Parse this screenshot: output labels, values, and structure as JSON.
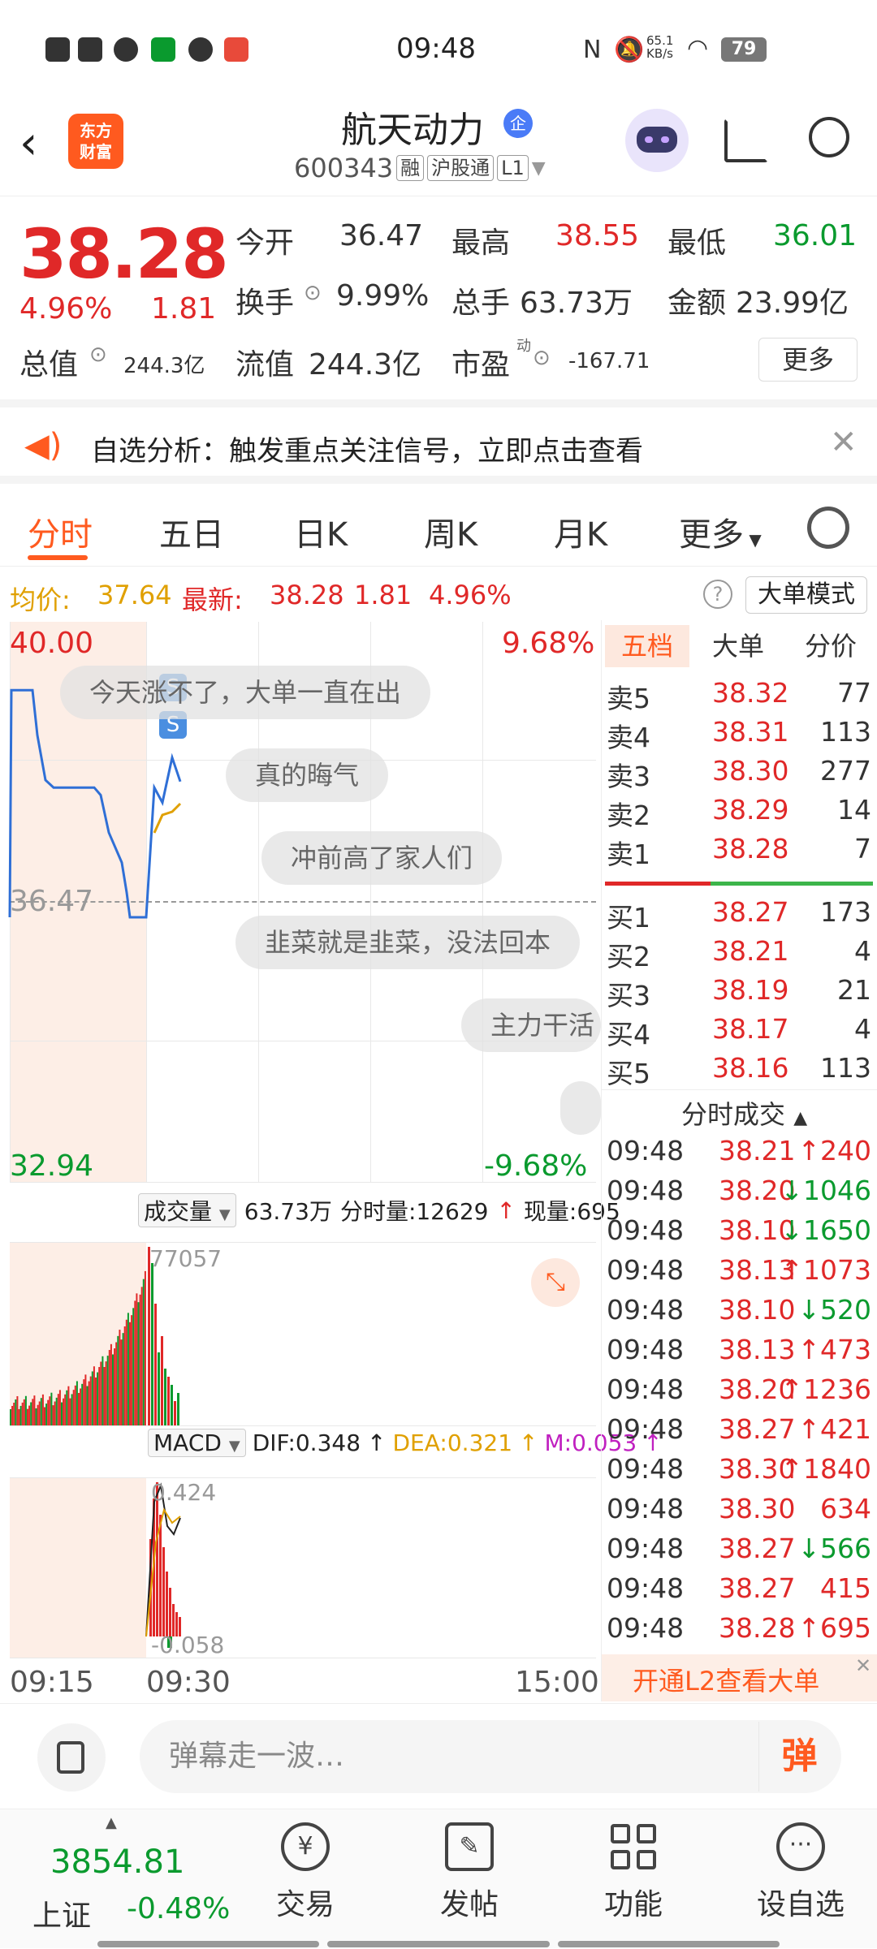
{
  "status_bar": {
    "time": "09:48",
    "net_speed": "65.1 KB/s",
    "battery": "79"
  },
  "header": {
    "logo_text_1": "东方",
    "logo_text_2": "财富",
    "stock_name": "航天动力",
    "name_badge": "企",
    "stock_code": "600343",
    "tags": [
      "融",
      "沪股通",
      "L1"
    ]
  },
  "quote": {
    "price": "38.28",
    "change_pct": "4.96%",
    "change": "1.81",
    "open_label": "今开",
    "open": "36.47",
    "high_label": "最高",
    "high": "38.55",
    "low_label": "最低",
    "low": "36.01",
    "turnover_label": "换手",
    "turnover": "9.99%",
    "volume_label": "总手",
    "volume": "63.73万",
    "amount_label": "金额",
    "amount": "23.99亿",
    "mcap_label": "总值",
    "mcap": "244.3亿",
    "float_label": "流值",
    "float": "244.3亿",
    "pe_label": "市盈",
    "pe_sup": "动",
    "pe": "-167.71",
    "more": "更多"
  },
  "banner": {
    "text": "自选分析：触发重点关注信号，立即点击查看"
  },
  "tabs": [
    "分时",
    "五日",
    "日K",
    "周K",
    "月K",
    "更多"
  ],
  "info_line": {
    "avg_label": "均价:",
    "avg": "37.64",
    "latest_label": "最新:",
    "latest": "38.28",
    "chg": "1.81",
    "chg_pct": "4.96%",
    "mode": "大单模式"
  },
  "chart": {
    "y_top": "40.00",
    "y_mid": "36.47",
    "y_bot": "32.94",
    "pct_top": "9.68%",
    "pct_bot": "-9.68%",
    "vol_label": "成交量",
    "vol_total": "63.73万",
    "vol_fenshi": "分时量:12629",
    "vol_now": "现量:695",
    "vol_max": "77057",
    "macd_label": "MACD",
    "dif": "DIF:0.348",
    "dea": "DEA:0.321",
    "m": "M:0.053",
    "macd_top": "0.424",
    "macd_bot": "-0.058",
    "time_start": "09:15",
    "time_mid": "09:30",
    "time_end": "15:00"
  },
  "danmu": [
    "今天涨不了，大单一直在出",
    "真的晦气",
    "冲前高了家人们",
    "韭菜就是韭菜，没法回本",
    "主力干活"
  ],
  "chart_data": {
    "type": "line",
    "title": "",
    "xlabel": "",
    "ylabel": "",
    "ylim": [
      32.94,
      40.0
    ],
    "series": [
      {
        "values": [
          36.47,
          39.5,
          39.5,
          38.9,
          38.3,
          38.2,
          38.2,
          38.2,
          38.1,
          37.6,
          37.2,
          36.8,
          36.47,
          36.47,
          38.2,
          38.0,
          38.6,
          38.28
        ]
      }
    ]
  },
  "book": {
    "tabs": [
      "五档",
      "大单",
      "分价"
    ],
    "sell": [
      {
        "label": "卖5",
        "price": "38.32",
        "vol": "77"
      },
      {
        "label": "卖4",
        "price": "38.31",
        "vol": "113"
      },
      {
        "label": "卖3",
        "price": "38.30",
        "vol": "277"
      },
      {
        "label": "卖2",
        "price": "38.29",
        "vol": "14"
      },
      {
        "label": "卖1",
        "price": "38.28",
        "vol": "7"
      }
    ],
    "buy": [
      {
        "label": "买1",
        "price": "38.27",
        "vol": "173"
      },
      {
        "label": "买2",
        "price": "38.21",
        "vol": "4"
      },
      {
        "label": "买3",
        "price": "38.19",
        "vol": "21"
      },
      {
        "label": "买4",
        "price": "38.17",
        "vol": "4"
      },
      {
        "label": "买5",
        "price": "38.16",
        "vol": "113"
      }
    ],
    "trades_title": "分时成交",
    "trades": [
      {
        "t": "09:48",
        "p": "38.21",
        "d": "↑",
        "v": "240",
        "c": "red"
      },
      {
        "t": "09:48",
        "p": "38.20",
        "d": "↓",
        "v": "1046",
        "c": "green"
      },
      {
        "t": "09:48",
        "p": "38.10",
        "d": "↓",
        "v": "1650",
        "c": "green"
      },
      {
        "t": "09:48",
        "p": "38.13",
        "d": "↑",
        "v": "1073",
        "c": "red"
      },
      {
        "t": "09:48",
        "p": "38.10",
        "d": "↓",
        "v": "520",
        "c": "green"
      },
      {
        "t": "09:48",
        "p": "38.13",
        "d": "↑",
        "v": "473",
        "c": "red"
      },
      {
        "t": "09:48",
        "p": "38.20",
        "d": "↑",
        "v": "1236",
        "c": "red"
      },
      {
        "t": "09:48",
        "p": "38.27",
        "d": "↑",
        "v": "421",
        "c": "red"
      },
      {
        "t": "09:48",
        "p": "38.30",
        "d": "↑",
        "v": "1840",
        "c": "red"
      },
      {
        "t": "09:48",
        "p": "38.30",
        "d": "",
        "v": "634",
        "c": "red"
      },
      {
        "t": "09:48",
        "p": "38.27",
        "d": "↓",
        "v": "566",
        "c": "green"
      },
      {
        "t": "09:48",
        "p": "38.27",
        "d": "",
        "v": "415",
        "c": "red"
      },
      {
        "t": "09:48",
        "p": "38.28",
        "d": "↑",
        "v": "695",
        "c": "red"
      }
    ],
    "l2_cta": "开通L2查看大单"
  },
  "input": {
    "placeholder": "弹幕走一波…",
    "send": "弹"
  },
  "nav": {
    "index_value": "3854.81",
    "index_name": "上证",
    "index_chg": "-0.48%",
    "items": [
      "交易",
      "发帖",
      "功能",
      "设自选"
    ]
  }
}
